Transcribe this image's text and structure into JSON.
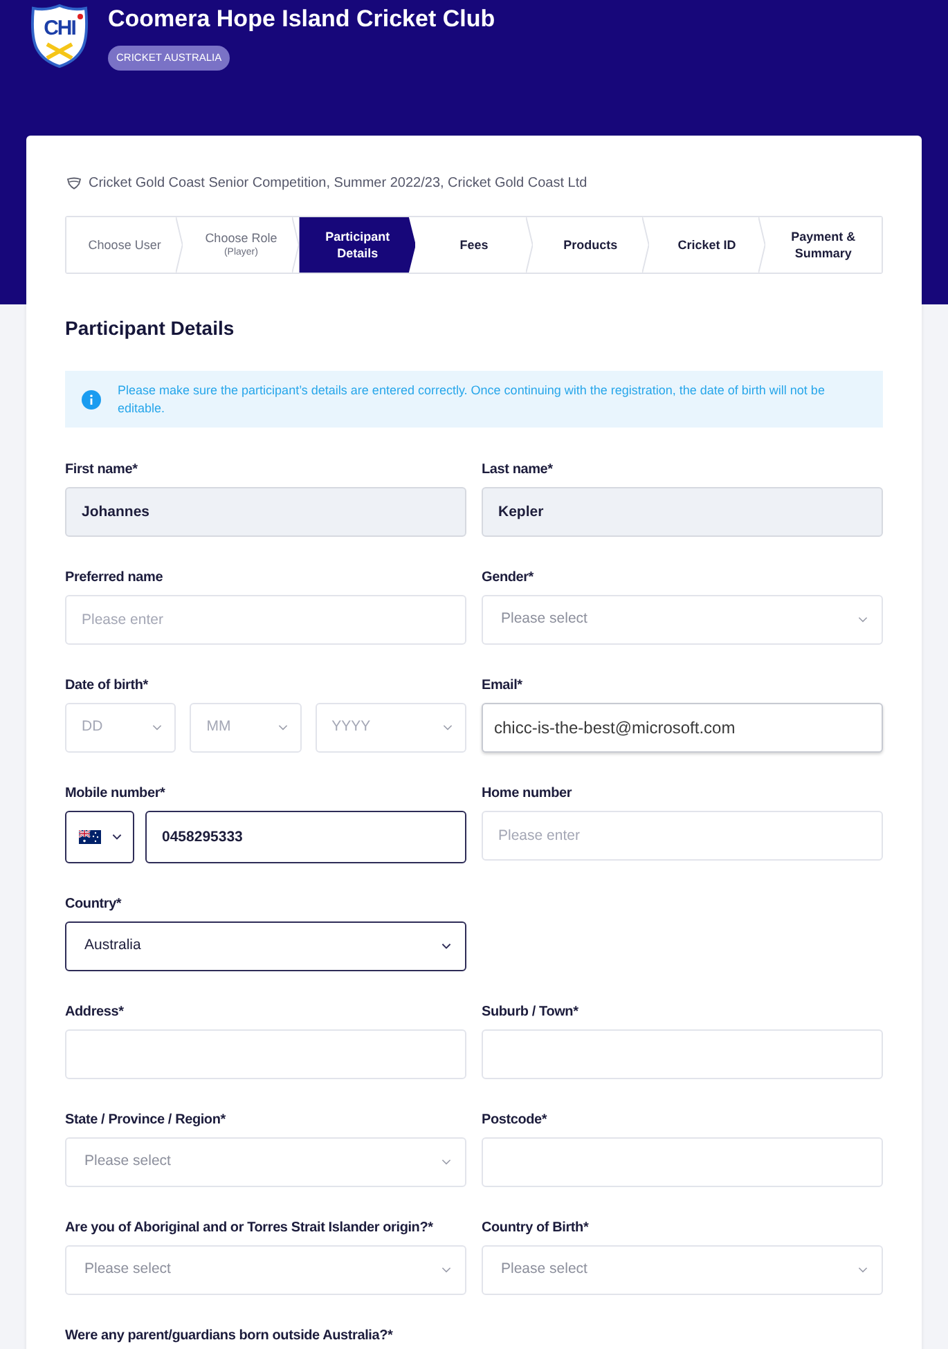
{
  "header": {
    "logo_text": "CHI",
    "title": "Coomera Hope Island Cricket Club",
    "badge": "CRICKET AUSTRALIA"
  },
  "competition": "Cricket Gold Coast Senior Competition, Summer 2022/23, Cricket Gold Coast Ltd",
  "steps": [
    {
      "label": "Choose User",
      "selected": false,
      "completed": true
    },
    {
      "label": "Choose Role",
      "sublabel": "(Player)",
      "selected": false,
      "completed": true
    },
    {
      "label": "Participant Details",
      "selected": true,
      "completed": false
    },
    {
      "label": "Fees",
      "selected": false,
      "completed": false
    },
    {
      "label": "Products",
      "selected": false,
      "completed": false
    },
    {
      "label": "Cricket ID",
      "selected": false,
      "completed": false
    },
    {
      "label": "Payment & Summary",
      "selected": false,
      "completed": false
    }
  ],
  "section_title": "Participant Details",
  "notice": "Please make sure the participant’s details are entered correctly. Once continuing with the registration, the date of birth will not be editable.",
  "rows": [
    [
      {
        "label": "First name*",
        "kind": "readonly",
        "value": "Johannes",
        "focused": false
      },
      {
        "label": "Last name*",
        "kind": "readonly",
        "value": "Kepler",
        "focused": false
      }
    ],
    [
      {
        "label": "Preferred name",
        "kind": "text",
        "placeholder": "Please enter",
        "focused": false
      },
      {
        "label": "Gender*",
        "kind": "select",
        "placeholder": "Please select",
        "focused": false
      }
    ],
    [
      {
        "label": "Date of birth*",
        "kind": "date",
        "parts": [
          {
            "placeholder": "DD"
          },
          {
            "placeholder": "MM"
          },
          {
            "placeholder": "YYYY"
          }
        ],
        "focused": false
      },
      {
        "label": "Email*",
        "kind": "email",
        "value": "chicc-is-the-best@microsoft.com",
        "focused": false
      }
    ],
    [
      {
        "label": "Mobile number*",
        "kind": "phone",
        "value": "0458295333",
        "focused": true
      },
      {
        "label": "Home number",
        "kind": "text",
        "placeholder": "Please enter",
        "focused": false
      }
    ],
    [
      {
        "label": "Country*",
        "kind": "select",
        "value": "Australia",
        "focused": true
      }
    ],
    [
      {
        "label": "Address*",
        "kind": "text",
        "focused": false
      },
      {
        "label": "Suburb / Town*",
        "kind": "text",
        "focused": false
      }
    ],
    [
      {
        "label": "State / Province / Region*",
        "kind": "select",
        "placeholder": "Please select",
        "focused": false
      },
      {
        "label": "Postcode*",
        "kind": "text",
        "focused": false
      }
    ],
    [
      {
        "label": "Are you of Aboriginal and or Torres Strait Islander origin?*",
        "kind": "select",
        "placeholder": "Please select",
        "focused": false
      },
      {
        "label": "Country of Birth*",
        "kind": "select",
        "placeholder": "Please select",
        "focused": false
      }
    ]
  ],
  "next_question": "Were any parent/guardians born outside Australia?*"
}
